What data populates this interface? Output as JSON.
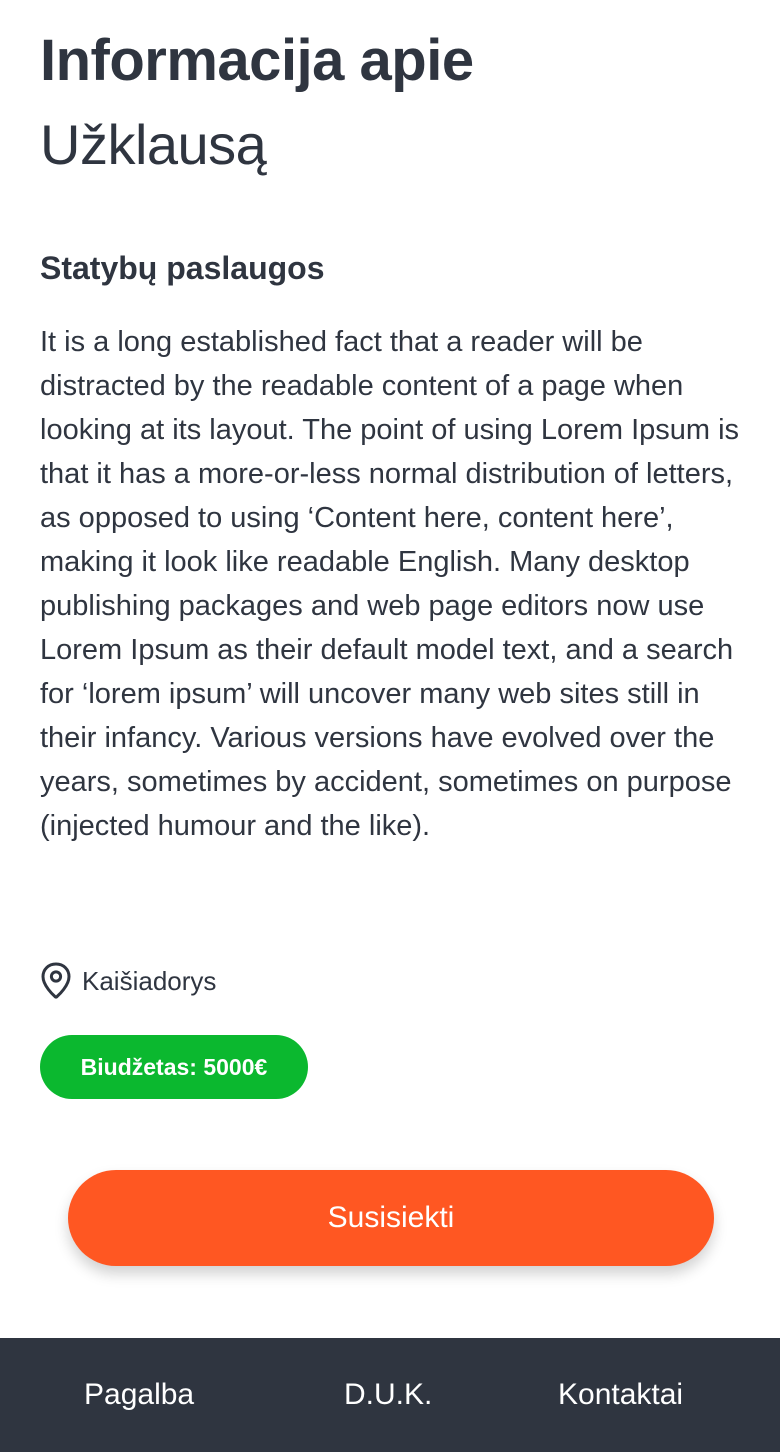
{
  "header": {
    "title_bold": "Informacija apie",
    "title_light": "Užklausą"
  },
  "request": {
    "service": "Statybų paslaugos",
    "description": "It is a long established fact that a reader will be distracted by the readable content of a page when looking at its layout. The point of using Lorem Ipsum is that it has a more-or-less normal distribution of letters, as opposed to using ‘Content here, content here’, making it look like readable English. Many desktop publishing packages and web page editors now use Lorem Ipsum as their default model text, and a search for ‘lorem ipsum’ will uncover many web sites still in their infancy. Various versions have evolved over the years, sometimes by accident, sometimes on purpose (injected humour and the like).",
    "location": "Kaišiadorys",
    "location_icon": "map-pin-icon",
    "budget": "Biudžetas: 5000€"
  },
  "actions": {
    "contact_label": "Susisiekti"
  },
  "footer": {
    "links": [
      "Pagalba",
      "D.U.K.",
      "Kontaktai"
    ]
  },
  "colors": {
    "text": "#2f3540",
    "budget_badge": "#0bb82f",
    "primary_button": "#ff5722",
    "footer_bg": "#2f3540"
  }
}
